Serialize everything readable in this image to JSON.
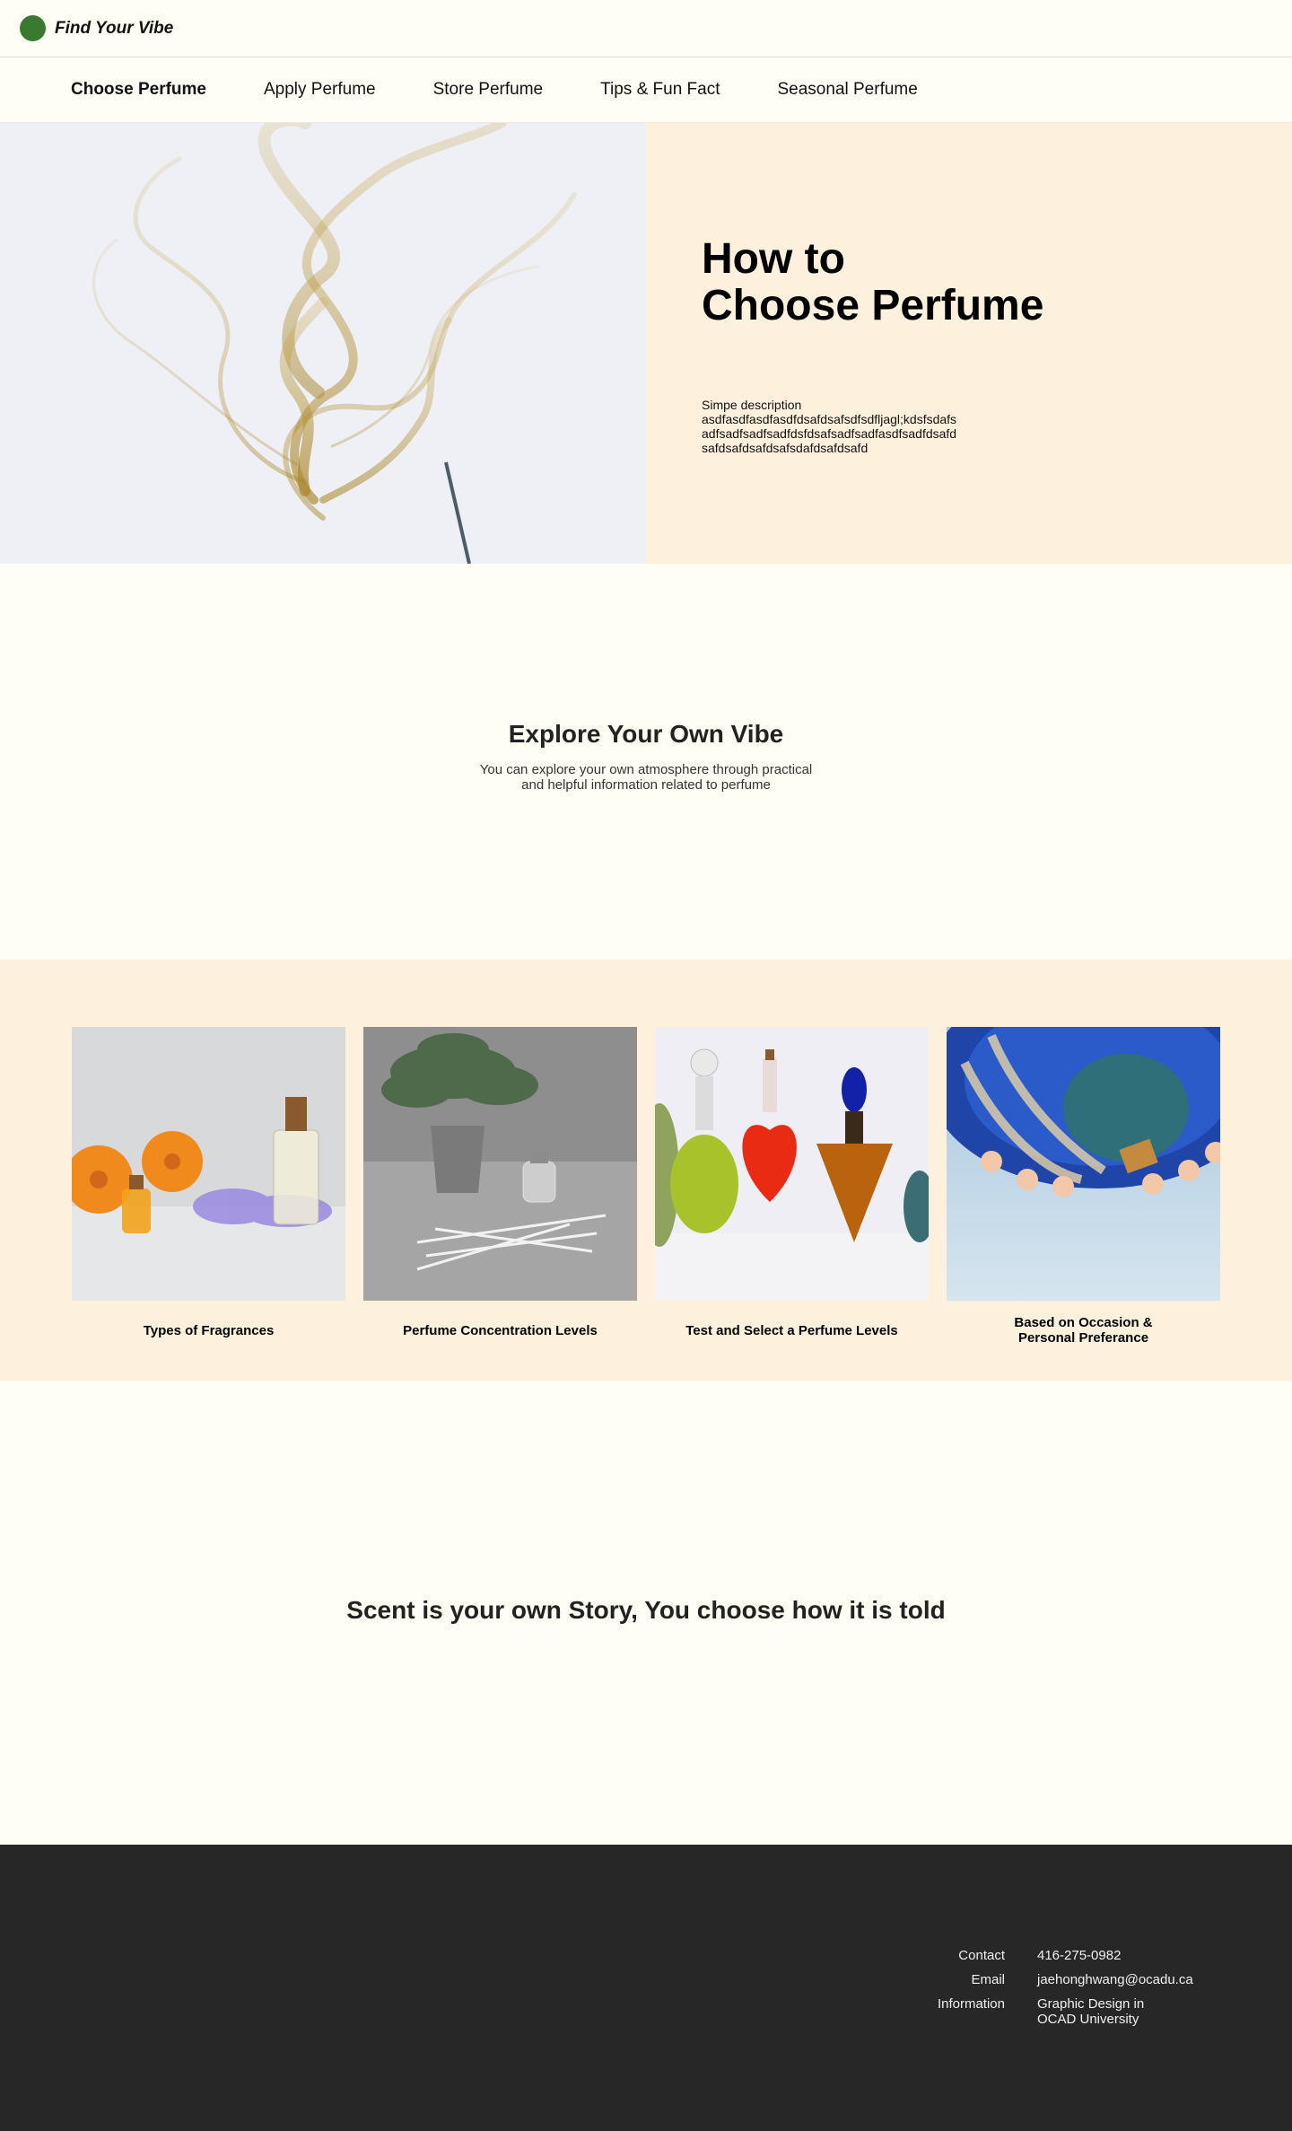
{
  "header": {
    "logo_text": "Find Your Vibe"
  },
  "nav": {
    "items": [
      {
        "label": "Choose Perfume",
        "active": true
      },
      {
        "label": "Apply Perfume"
      },
      {
        "label": "Store Perfume"
      },
      {
        "label": "Tips & Fun Fact"
      },
      {
        "label": "Seasonal Perfume"
      }
    ]
  },
  "hero": {
    "title": "How to\nChoose Perfume",
    "description": "Simpe description\nasdfasdfasdfasdfdsafdsafsdfsdfljagl;kdsfsdafs\nadfsadfsadfsadfdsfdsafsadfsadfasdfsadfdsafd\nsafdsafdsafdsafsdafdsafdsafd"
  },
  "explore": {
    "title": "Explore Your Own Vibe",
    "subtitle": "You can explore your own atmosphere through practical\nand helpful information related to perfume"
  },
  "cards": [
    {
      "label": "Types of Fragrances",
      "image": "perfume-bottles-flowers"
    },
    {
      "label": "Perfume Concentration Levels",
      "image": "reed-diffuser-plant"
    },
    {
      "label": "Test and Select a Perfume Levels",
      "image": "colorful-perfume-bottles"
    },
    {
      "label": "Based on Occasion &\nPersonal Preferance",
      "image": "hot-air-balloon"
    }
  ],
  "story": {
    "text": "Scent is your own Story, You choose how it is told"
  },
  "footer": {
    "contact_label": "Contact",
    "contact_value": "416-275-0982",
    "email_label": "Email",
    "email_value": "jaehonghwang@ocadu.ca",
    "info_label": "Information",
    "info_value": "Graphic Design in\nOCAD University"
  },
  "colors": {
    "page_bg": "#fffef5",
    "cream_band": "#fdf1dd",
    "logo_green": "#3a7a30",
    "footer_bg": "#272727"
  }
}
